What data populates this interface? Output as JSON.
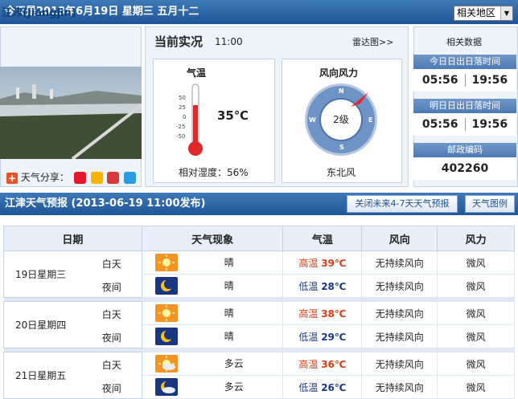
{
  "header": {
    "date_text": "今天是2013年6月19日 星期三 五月十二",
    "region_select": "相关地区"
  },
  "city": {
    "name": "江津(Jiangjin)",
    "share_label": "天气分享："
  },
  "current": {
    "title": "当前实况",
    "time": "11:00",
    "radar_link": "雷达图>>",
    "temp_title": "气温",
    "temp_value": "35℃",
    "temp_ticks": [
      "50",
      "25",
      "0",
      "-25",
      "-50"
    ],
    "humidity": "相对湿度：56%",
    "wind_title": "风向风力",
    "wind_level": "2级",
    "wind_dir": "东北风",
    "rose": [
      "N",
      "E",
      "S",
      "W"
    ]
  },
  "side": {
    "title": "相关数据",
    "today_label": "今日日出日落时间",
    "today_rise": "05:56",
    "today_set": "19:56",
    "tomorrow_label": "明日日出日落时间",
    "tomorrow_rise": "05:56",
    "tomorrow_set": "19:56",
    "postcode_label": "邮政编码",
    "postcode": "402260"
  },
  "forecast": {
    "title": "江津天气预报 (2013-06-19 11:00发布)",
    "btn_close": "关闭未来4-7天天气预报",
    "btn_legend": "天气图例",
    "headers": [
      "日期",
      "天气现象",
      "气温",
      "风向",
      "风力"
    ],
    "days": [
      {
        "date": "19日星期三",
        "rows": [
          {
            "period": "白天",
            "icon": "sun-icon",
            "phen": "晴",
            "tl": "高温",
            "tv": "39℃",
            "dir": "无持续风向",
            "force": "微风"
          },
          {
            "period": "夜间",
            "icon": "moon-icon",
            "phen": "晴",
            "tl": "低温",
            "tv": "28℃",
            "dir": "无持续风向",
            "force": "微风"
          }
        ]
      },
      {
        "date": "20日星期四",
        "rows": [
          {
            "period": "白天",
            "icon": "sun-icon",
            "phen": "晴",
            "tl": "高温",
            "tv": "38℃",
            "dir": "无持续风向",
            "force": "微风"
          },
          {
            "period": "夜间",
            "icon": "moon-icon",
            "phen": "晴",
            "tl": "低温",
            "tv": "29℃",
            "dir": "无持续风向",
            "force": "微风"
          }
        ]
      },
      {
        "date": "21日星期五",
        "rows": [
          {
            "period": "白天",
            "icon": "sun-cloud-icon",
            "phen": "多云",
            "tl": "高温",
            "tv": "36℃",
            "dir": "无持续风向",
            "force": "微风"
          },
          {
            "period": "夜间",
            "icon": "moon-cloud-icon",
            "phen": "多云",
            "tl": "低温",
            "tv": "26℃",
            "dir": "无持续风向",
            "force": "微风"
          }
        ]
      }
    ]
  },
  "colors": {
    "brand": "#2a63a6",
    "hot": "#d93b13",
    "cold": "#1a3680"
  }
}
